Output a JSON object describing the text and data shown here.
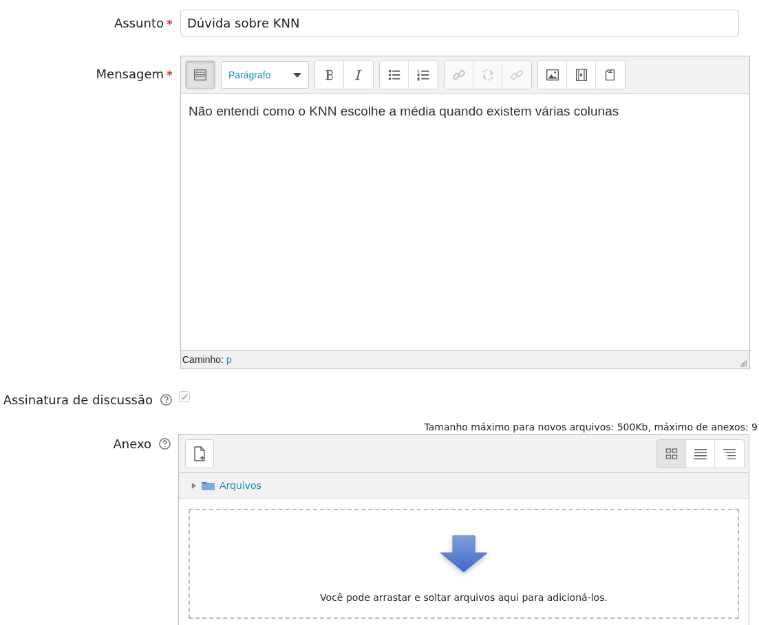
{
  "subject": {
    "label": "Assunto",
    "required": true,
    "value": "Dúvida sobre KNN"
  },
  "message": {
    "label": "Mensagem",
    "required": true,
    "toolbar": [
      {
        "kind": "buttons",
        "buttons": [
          {
            "kind": "toggle",
            "disabled": false,
            "pressed": true
          }
        ]
      },
      {
        "kind": "select",
        "value": "Parágrafo"
      },
      {
        "kind": "buttons",
        "buttons": [
          {
            "kind": "bold",
            "disabled": false,
            "pressed": false
          },
          {
            "kind": "italic",
            "disabled": false,
            "pressed": false
          }
        ]
      },
      {
        "kind": "buttons",
        "buttons": [
          {
            "kind": "bullets",
            "disabled": false,
            "pressed": false
          },
          {
            "kind": "numbers",
            "disabled": false,
            "pressed": false
          }
        ]
      },
      {
        "kind": "buttons",
        "buttons": [
          {
            "kind": "link",
            "disabled": true,
            "pressed": false
          },
          {
            "kind": "unlink",
            "disabled": true,
            "pressed": false
          },
          {
            "kind": "anchor",
            "disabled": true,
            "pressed": false
          }
        ]
      },
      {
        "kind": "buttons",
        "buttons": [
          {
            "kind": "image",
            "disabled": false,
            "pressed": false
          },
          {
            "kind": "media",
            "disabled": false,
            "pressed": false
          },
          {
            "kind": "clipboard",
            "disabled": false,
            "pressed": false
          }
        ]
      }
    ],
    "body": "Não entendi como o KNN escolhe a média quando existem várias colunas",
    "path_label": "Caminho:",
    "path": "p"
  },
  "subscription": {
    "label": "Assinatura de discussão",
    "help": true,
    "checked": true,
    "disabled": true
  },
  "attachment": {
    "label": "Anexo",
    "help": true,
    "limits": "Tamanho máximo para novos arquivos: 500Kb, máximo de anexos: 9",
    "views": [
      {
        "kind": "icons",
        "selected": true
      },
      {
        "kind": "list",
        "selected": false
      },
      {
        "kind": "tree",
        "selected": false
      }
    ],
    "folder": {
      "name": "Arquivos",
      "expanded": false
    },
    "drop_hint": "Você pode arrastar e soltar arquivos aqui para adicioná-los."
  }
}
